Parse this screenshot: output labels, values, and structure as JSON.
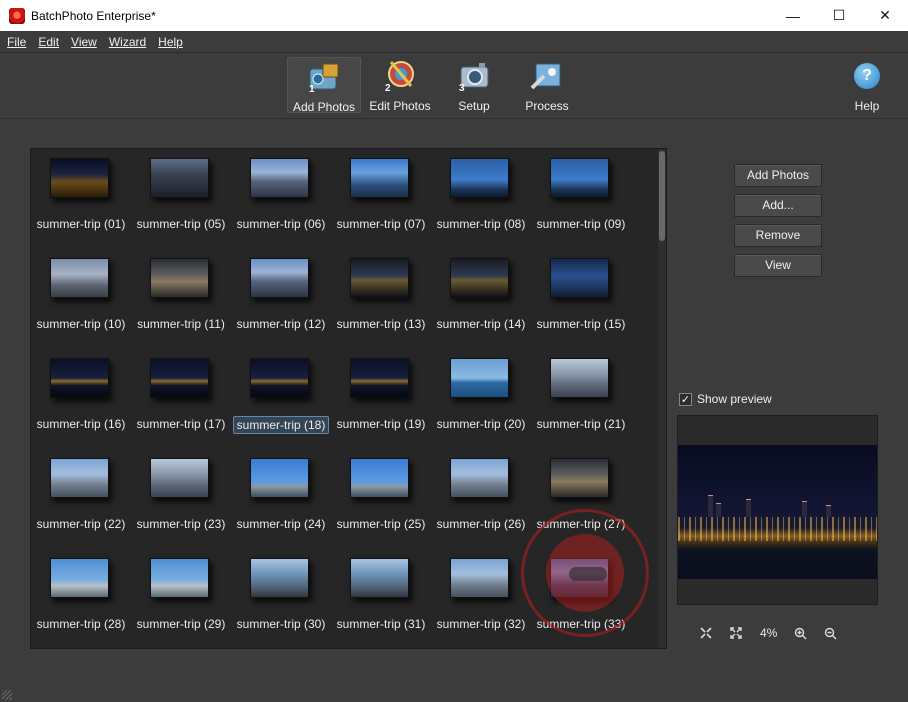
{
  "window": {
    "title": "BatchPhoto Enterprise*",
    "minimize": "—",
    "maximize": "☐",
    "close": "✕"
  },
  "menu": [
    "File",
    "Edit",
    "View",
    "Wizard",
    "Help"
  ],
  "toolbar": {
    "tools": [
      {
        "num": "1",
        "label": "Add Photos",
        "icon": "add-photos-icon"
      },
      {
        "num": "2",
        "label": "Edit Photos",
        "icon": "edit-photos-icon"
      },
      {
        "num": "3",
        "label": "Setup",
        "icon": "setup-icon"
      },
      {
        "num": "",
        "label": "Process",
        "icon": "process-icon"
      }
    ],
    "help": {
      "label": "Help",
      "glyph": "?"
    }
  },
  "photos": [
    "summer-trip (01)",
    "summer-trip (05)",
    "summer-trip (06)",
    "summer-trip (07)",
    "summer-trip (08)",
    "summer-trip (09)",
    "summer-trip (10)",
    "summer-trip (11)",
    "summer-trip (12)",
    "summer-trip (13)",
    "summer-trip (14)",
    "summer-trip (15)",
    "summer-trip (16)",
    "summer-trip (17)",
    "summer-trip (18)",
    "summer-trip (19)",
    "summer-trip (20)",
    "summer-trip (21)",
    "summer-trip (22)",
    "summer-trip (23)",
    "summer-trip (24)",
    "summer-trip (25)",
    "summer-trip (26)",
    "summer-trip (27)",
    "summer-trip (28)",
    "summer-trip (29)",
    "summer-trip (30)",
    "summer-trip (31)",
    "summer-trip (32)",
    "summer-trip (33)"
  ],
  "selected_photo": "summer-trip (18)",
  "side_buttons": [
    "Add Photos",
    "Add...",
    "Remove",
    "View"
  ],
  "preview": {
    "show_label": "Show preview",
    "checked": "✓",
    "zoom": "4%"
  }
}
